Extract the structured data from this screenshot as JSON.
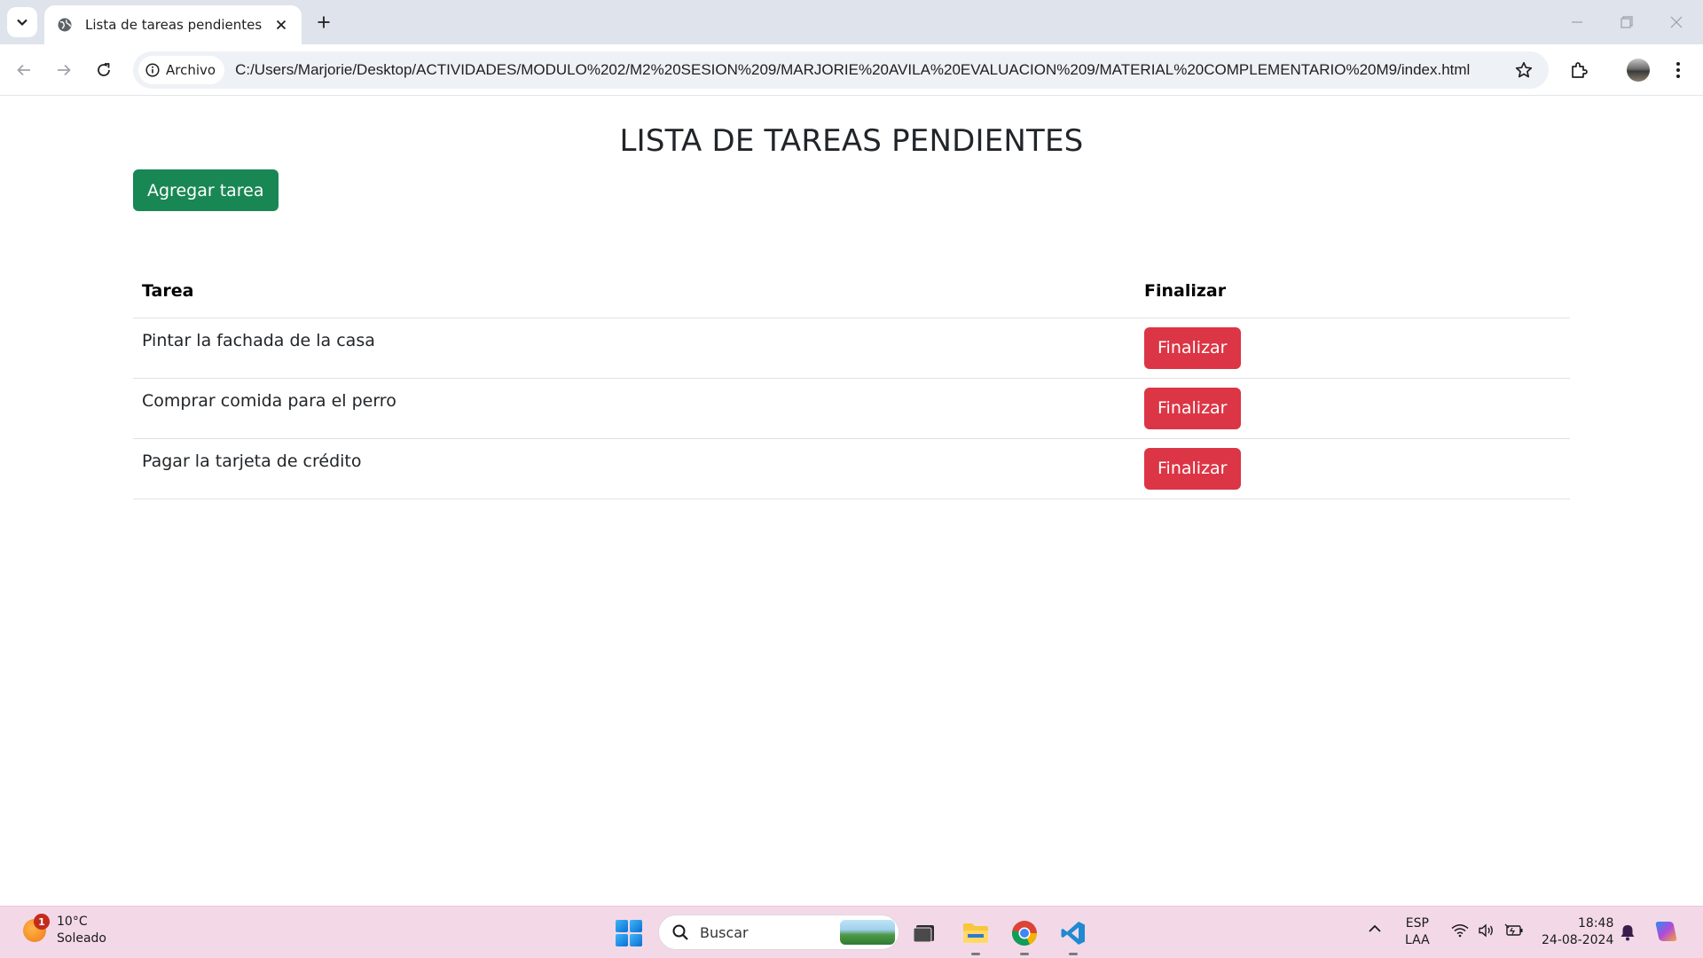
{
  "browser": {
    "tab_title": "Lista de tareas pendientes",
    "address_chip": "Archivo",
    "url": "C:/Users/Marjorie/Desktop/ACTIVIDADES/MODULO%202/M2%20SESION%209/MARJORIE%20AVILA%20EVALUACION%209/MATERIAL%20COMPLEMENTARIO%20M9/index.html"
  },
  "page": {
    "heading": "LISTA DE TAREAS PENDIENTES",
    "add_button": "Agregar tarea",
    "table": {
      "headers": [
        "Tarea",
        "Finalizar"
      ],
      "rows": [
        {
          "task": "Pintar la fachada de la casa",
          "action": "Finalizar"
        },
        {
          "task": "Comprar comida para el perro",
          "action": "Finalizar"
        },
        {
          "task": "Pagar la tarjeta de crédito",
          "action": "Finalizar"
        }
      ]
    }
  },
  "taskbar": {
    "weather_temp": "10°C",
    "weather_desc": "Soleado",
    "weather_badge": "1",
    "search_placeholder": "Buscar",
    "lang_1": "ESP",
    "lang_2": "LAA",
    "time": "18:48",
    "date": "24-08-2024"
  },
  "colors": {
    "success": "#198754",
    "danger": "#dc3545",
    "taskbar": "#f3d9e8"
  }
}
